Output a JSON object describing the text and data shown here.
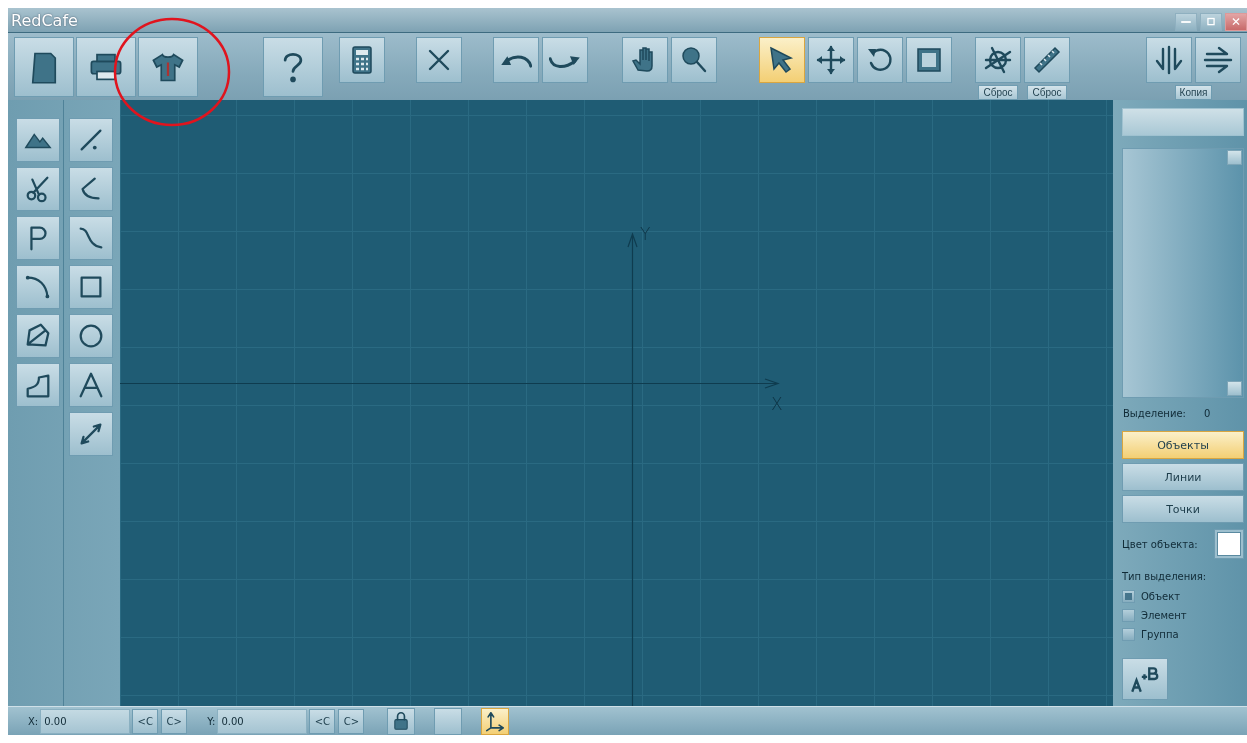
{
  "window": {
    "title": "RedCafe"
  },
  "toolbar": {
    "groups": [
      {
        "buttons": [
          {
            "kind": "large",
            "selected": false
          },
          {
            "kind": "large",
            "selected": false
          },
          {
            "kind": "large",
            "selected": false
          }
        ]
      },
      {
        "buttons": [
          {
            "kind": "large",
            "selected": false
          }
        ]
      },
      {
        "buttons": [
          {
            "kind": "small",
            "selected": false
          }
        ]
      },
      {
        "buttons": [
          {
            "kind": "small",
            "selected": false
          }
        ]
      },
      {
        "buttons": [
          {
            "kind": "small",
            "selected": false
          },
          {
            "kind": "small",
            "selected": false
          }
        ]
      },
      {
        "buttons": [
          {
            "kind": "small",
            "selected": false
          },
          {
            "kind": "small",
            "selected": false
          }
        ]
      },
      {
        "buttons": [
          {
            "kind": "small",
            "selected": true
          },
          {
            "kind": "small",
            "selected": false
          },
          {
            "kind": "small",
            "selected": false
          },
          {
            "kind": "small",
            "selected": false
          }
        ]
      },
      {
        "buttons": [
          {
            "kind": "small",
            "selected": false,
            "caption": "Сброс"
          },
          {
            "kind": "small",
            "selected": false,
            "caption": "Сброс"
          }
        ]
      },
      {
        "buttons": [
          {
            "kind": "small",
            "selected": false
          },
          {
            "kind": "small",
            "selected": false
          }
        ],
        "caption": "Копия"
      }
    ]
  },
  "left_tools": {
    "columns": [
      [
        {
          "selected": false
        },
        {
          "selected": false
        },
        {
          "selected": false
        },
        {
          "selected": false
        },
        {
          "selected": false
        },
        {
          "selected": false
        }
      ],
      [
        {
          "selected": false
        },
        {
          "selected": false
        },
        {
          "selected": false
        },
        {
          "selected": false
        },
        {
          "selected": false
        },
        {
          "selected": false
        },
        {
          "selected": false
        }
      ]
    ]
  },
  "canvas": {
    "x_axis_label": "X",
    "y_axis_label": "Y"
  },
  "right_panel": {
    "selection_label": "Выделение:",
    "selection_count": "0",
    "filters": [
      {
        "label": "Объекты",
        "selected": true
      },
      {
        "label": "Линии",
        "selected": false
      },
      {
        "label": "Точки",
        "selected": false
      }
    ],
    "color_label": "Цвет объекта:",
    "color": "#ffffff",
    "selection_type_label": "Тип выделения:",
    "selection_types": [
      {
        "label": "Объект",
        "checked": true
      },
      {
        "label": "Элемент",
        "checked": false
      },
      {
        "label": "Группа",
        "checked": false
      }
    ]
  },
  "status_bar": {
    "coords": [
      {
        "label": "X:",
        "value": "0.00",
        "prev": "<C",
        "next": "C>"
      },
      {
        "label": "Y:",
        "value": "0.00",
        "prev": "<C",
        "next": "C>"
      }
    ],
    "toggles": [
      {
        "selected": false
      },
      {
        "selected": false
      },
      {
        "selected": true
      }
    ]
  }
}
